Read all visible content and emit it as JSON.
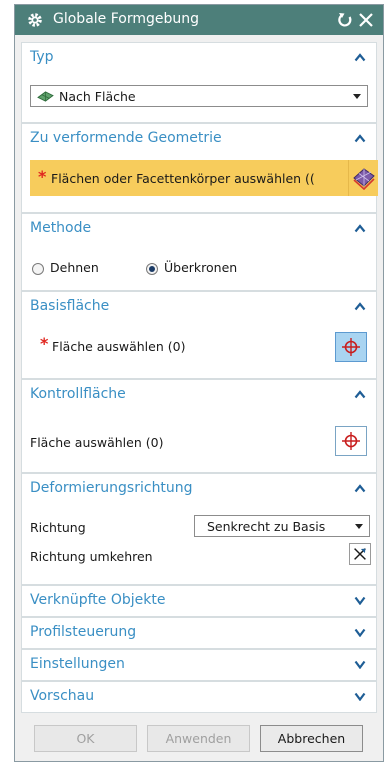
{
  "dialog": {
    "title": "Globale Formgebung"
  },
  "typ": {
    "title": "Typ",
    "selected": "Nach Fläche"
  },
  "geometrie": {
    "title": "Zu verformende Geometrie",
    "prompt": "Flächen oder Facettenkörper auswählen (("
  },
  "methode": {
    "title": "Methode",
    "options": [
      "Dehnen",
      "Überkronen"
    ],
    "selected": "Überkronen"
  },
  "basisflaeche": {
    "title": "Basisfläche",
    "prompt": "Fläche auswählen (0)"
  },
  "kontrollflaeche": {
    "title": "Kontrollfläche",
    "prompt": "Fläche auswählen (0)"
  },
  "deformierung": {
    "title": "Deformierungsrichtung",
    "richtung_label": "Richtung",
    "richtung_value": "Senkrecht zu Basis",
    "umkehren_label": "Richtung umkehren"
  },
  "collapsed_sections": [
    "Verknüpfte Objekte",
    "Profilsteuerung",
    "Einstellungen",
    "Vorschau"
  ],
  "buttons": {
    "ok": "OK",
    "anwenden": "Anwenden",
    "abbrechen": "Abbrechen"
  },
  "required_marker": "*",
  "colors": {
    "titlebar": "#4d7f7a",
    "section_title": "#3a8fc4",
    "highlight": "#f7cc5c",
    "required": "#e0261f"
  },
  "icons": [
    "gear-icon",
    "reset-icon",
    "close-icon",
    "surface-icon",
    "face-select-icon",
    "crosshair-icon",
    "reverse-direction-icon"
  ]
}
